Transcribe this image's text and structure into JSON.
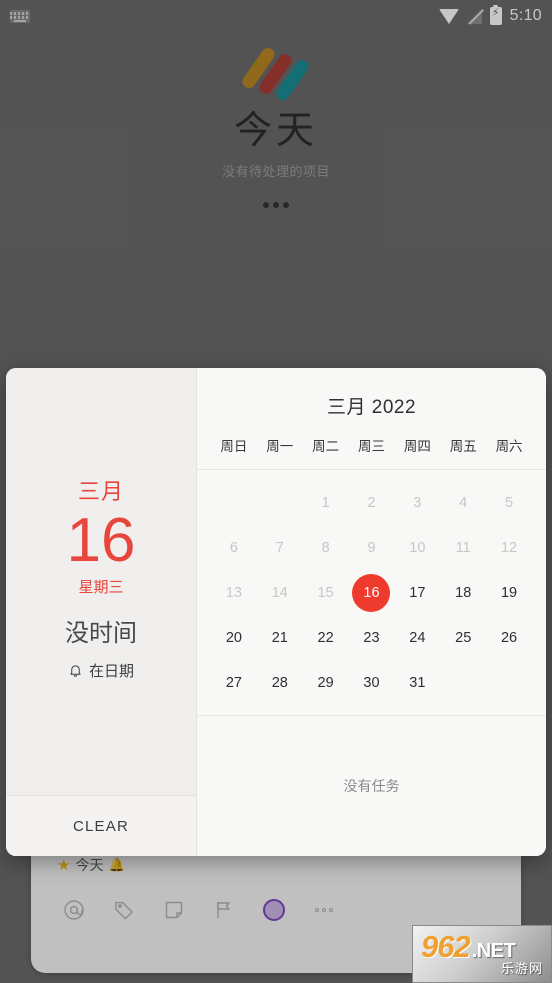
{
  "status_bar": {
    "keyboard_icon": "keyboard-icon",
    "wifi_icon": "wifi-icon",
    "signal_icon": "signal-off-icon",
    "battery_icon": "battery-charging-icon",
    "clock": "5:10"
  },
  "hero": {
    "logo_icon": "app-logo-icon",
    "logo_colors": [
      "#c08a1c",
      "#b03a33",
      "#13939b"
    ],
    "title": "今天",
    "subtitle": "没有待处理的项目",
    "overflow_icon": "three-dots-icon"
  },
  "composer": {
    "project_label": "今天",
    "star_icon": "star-icon",
    "bell_icon": "bell-icon",
    "toolbar": [
      {
        "name": "mention-icon",
        "label": "@"
      },
      {
        "name": "label-tag-icon",
        "label": ""
      },
      {
        "name": "note-icon",
        "label": ""
      },
      {
        "name": "flag-icon",
        "label": ""
      },
      {
        "name": "priority-circle-icon",
        "label": "",
        "color": "#7b49c0"
      },
      {
        "name": "more-options-icon",
        "label": ""
      }
    ]
  },
  "dialog": {
    "summary": {
      "month": "三月",
      "day": "16",
      "weekday": "星期三",
      "time": "没时间",
      "reminder_icon": "bell-icon",
      "reminder_label": "在日期",
      "accent_color": "#e8453c"
    },
    "clear_label": "CLEAR",
    "calendar": {
      "title": "三月 2022",
      "weekdays": [
        "周日",
        "周一",
        "周二",
        "周三",
        "周四",
        "周五",
        "周六"
      ],
      "lead_blanks": 2,
      "days": [
        {
          "n": "1",
          "state": "past"
        },
        {
          "n": "2",
          "state": "past"
        },
        {
          "n": "3",
          "state": "past"
        },
        {
          "n": "4",
          "state": "past"
        },
        {
          "n": "5",
          "state": "past"
        },
        {
          "n": "6",
          "state": "past"
        },
        {
          "n": "7",
          "state": "past"
        },
        {
          "n": "8",
          "state": "past"
        },
        {
          "n": "9",
          "state": "past"
        },
        {
          "n": "10",
          "state": "past"
        },
        {
          "n": "11",
          "state": "past"
        },
        {
          "n": "12",
          "state": "past"
        },
        {
          "n": "13",
          "state": "past"
        },
        {
          "n": "14",
          "state": "past"
        },
        {
          "n": "15",
          "state": "past"
        },
        {
          "n": "16",
          "state": "selected"
        },
        {
          "n": "17",
          "state": "normal"
        },
        {
          "n": "18",
          "state": "normal"
        },
        {
          "n": "19",
          "state": "normal"
        },
        {
          "n": "20",
          "state": "normal"
        },
        {
          "n": "21",
          "state": "normal"
        },
        {
          "n": "22",
          "state": "normal"
        },
        {
          "n": "23",
          "state": "normal"
        },
        {
          "n": "24",
          "state": "normal"
        },
        {
          "n": "25",
          "state": "normal"
        },
        {
          "n": "26",
          "state": "normal"
        },
        {
          "n": "27",
          "state": "normal"
        },
        {
          "n": "28",
          "state": "normal"
        },
        {
          "n": "29",
          "state": "normal"
        },
        {
          "n": "30",
          "state": "normal"
        },
        {
          "n": "31",
          "state": "normal"
        }
      ],
      "selected_color": "#ee3b2d"
    },
    "tasks_empty_label": "没有任务"
  },
  "watermark": {
    "number": "962",
    "domain": ".NET",
    "chinese": "乐游网"
  }
}
